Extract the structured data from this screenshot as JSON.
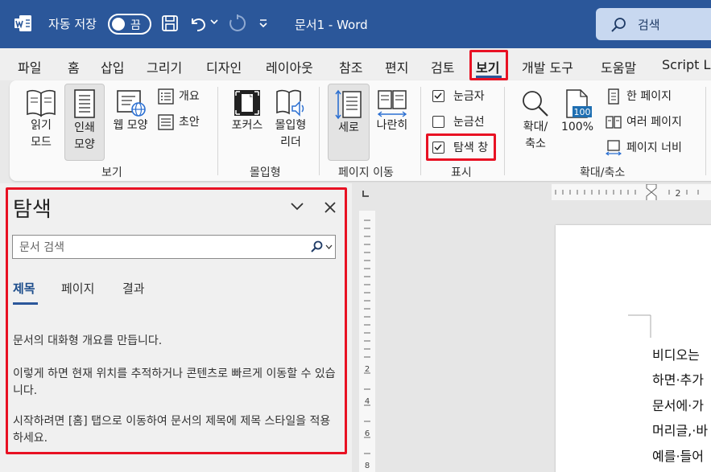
{
  "titlebar": {
    "autosave_label": "자동 저장",
    "autosave_state": "끔",
    "document_name": "문서1  -  Word",
    "search_placeholder": "검색"
  },
  "menu_tabs": [
    {
      "label": "파일"
    },
    {
      "label": "홈"
    },
    {
      "label": "삽입"
    },
    {
      "label": "그리기"
    },
    {
      "label": "디자인"
    },
    {
      "label": "레이아웃"
    },
    {
      "label": "참조"
    },
    {
      "label": "편지"
    },
    {
      "label": "검토"
    },
    {
      "label": "보기",
      "active": true
    },
    {
      "label": "개발 도구"
    },
    {
      "label": "도움말"
    },
    {
      "label": "Script La"
    }
  ],
  "ribbon": {
    "views": {
      "read_mode": "읽기\n모드",
      "print_layout": "인쇄\n모양",
      "web_layout": "웹 모양",
      "outline": "개요",
      "draft": "초안",
      "group_label": "보기"
    },
    "immersive": {
      "focus": "포커스",
      "immersive_reader": "몰입형\n리더",
      "group_label": "몰입형"
    },
    "page_movement": {
      "vertical": "세로",
      "side_to_side": "나란히",
      "group_label": "페이지 이동"
    },
    "show": {
      "ruler": "눈금자",
      "ruler_checked": true,
      "gridlines": "눈금선",
      "gridlines_checked": false,
      "navigation_pane": "탐색 창",
      "navigation_pane_checked": true,
      "group_label": "표시"
    },
    "zoom": {
      "zoom": "확대/\n축소",
      "percent_100": "100%",
      "percent_icon_text": "100",
      "one_page": "한 페이지",
      "multiple_pages": "여러 페이지",
      "page_width": "페이지 너비",
      "group_label": "확대/축소"
    }
  },
  "navpane": {
    "title": "탐색",
    "search_placeholder": "문서 검색",
    "tabs": [
      {
        "label": "제목",
        "active": true
      },
      {
        "label": "페이지"
      },
      {
        "label": "결과"
      }
    ],
    "paragraphs": [
      "문서의 대화형 개요를 만듭니다.",
      "이렇게 하면 현재 위치를 추적하거나 콘텐츠로 빠르게 이동할 수 있습니다.",
      "시작하려면 [홈] 탭으로 이동하여 문서의 제목에 제목 스타일을 적용하세요."
    ]
  },
  "rulers": {
    "horizontal_label": "2",
    "vertical_labels": [
      "2",
      "4",
      "6",
      "8"
    ]
  },
  "document": {
    "lines": [
      "비디오는",
      "하면·추가",
      "문서에·가",
      "머리글,·바",
      "예를·들어"
    ]
  },
  "colors": {
    "title_bar": "#2b579a",
    "highlight_box": "#e81123",
    "accent": "#2b579a"
  }
}
